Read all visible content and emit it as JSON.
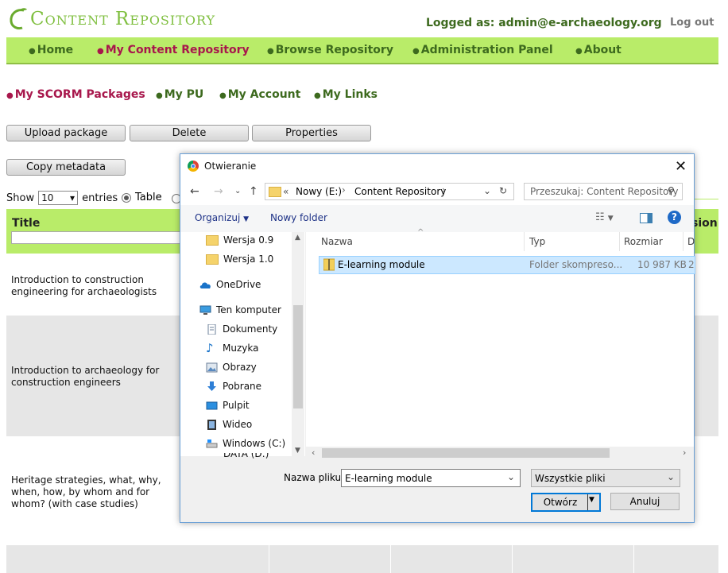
{
  "header": {
    "logo_text": "Content Repository",
    "logged_as": "Logged as: admin@e-archaeology.org",
    "logout": "Log out"
  },
  "main_nav": [
    "Home",
    "My Content Repository",
    "Browse Repository",
    "Administration Panel",
    "About"
  ],
  "sub_nav": [
    "My SCORM Packages",
    "My PU",
    "My Account",
    "My Links"
  ],
  "buttons": {
    "upload": "Upload package",
    "delete": "Delete",
    "properties": "Properties",
    "copy_metadata": "Copy metadata"
  },
  "table_controls": {
    "show": "Show",
    "entries_value": "10",
    "entries": "entries",
    "view_table": "Table"
  },
  "table": {
    "col_title": "Title",
    "col_version_partial": "sion",
    "rows": [
      "Introduction to construction engineering for archaeologists",
      "Introduction to archaeology for construction engineers",
      "Heritage strategies, what, why, when, how, by whom and for whom? (with case studies)"
    ]
  },
  "dialog": {
    "title": "Otwieranie",
    "address": {
      "prefix": "«",
      "drive": "Nowy (E:)",
      "folder": "Content Repository"
    },
    "search_placeholder": "Przeszukaj: Content Repository",
    "toolbar": {
      "organize": "Organizuj",
      "new_folder": "Nowy folder"
    },
    "tree": [
      {
        "label": "Wersja 0.9",
        "icon": "folder-icon"
      },
      {
        "label": "Wersja 1.0",
        "icon": "folder-icon"
      },
      {
        "label": "OneDrive",
        "icon": "cloud-icon"
      },
      {
        "label": "Ten komputer",
        "icon": "computer-icon"
      },
      {
        "label": "Dokumenty",
        "icon": "document-icon"
      },
      {
        "label": "Muzyka",
        "icon": "music-icon"
      },
      {
        "label": "Obrazy",
        "icon": "picture-icon"
      },
      {
        "label": "Pobrane",
        "icon": "download-icon"
      },
      {
        "label": "Pulpit",
        "icon": "desktop-icon"
      },
      {
        "label": "Wideo",
        "icon": "video-icon"
      },
      {
        "label": "Windows (C:)",
        "icon": "drive-icon"
      },
      {
        "label": "DATA (D:)",
        "icon": "drive-icon"
      }
    ],
    "columns": {
      "name": "Nazwa",
      "type": "Typ",
      "size": "Rozmiar",
      "date_partial": "D"
    },
    "file": {
      "name": "E-learning module",
      "type": "Folder skompreso...",
      "size": "10 987 KB",
      "date_partial": "2"
    },
    "filename_label": "Nazwa pliku:",
    "filename_value": "E-learning module",
    "filter_value": "Wszystkie pliki",
    "open_button": "Otwórz",
    "cancel_button": "Anuluj"
  }
}
